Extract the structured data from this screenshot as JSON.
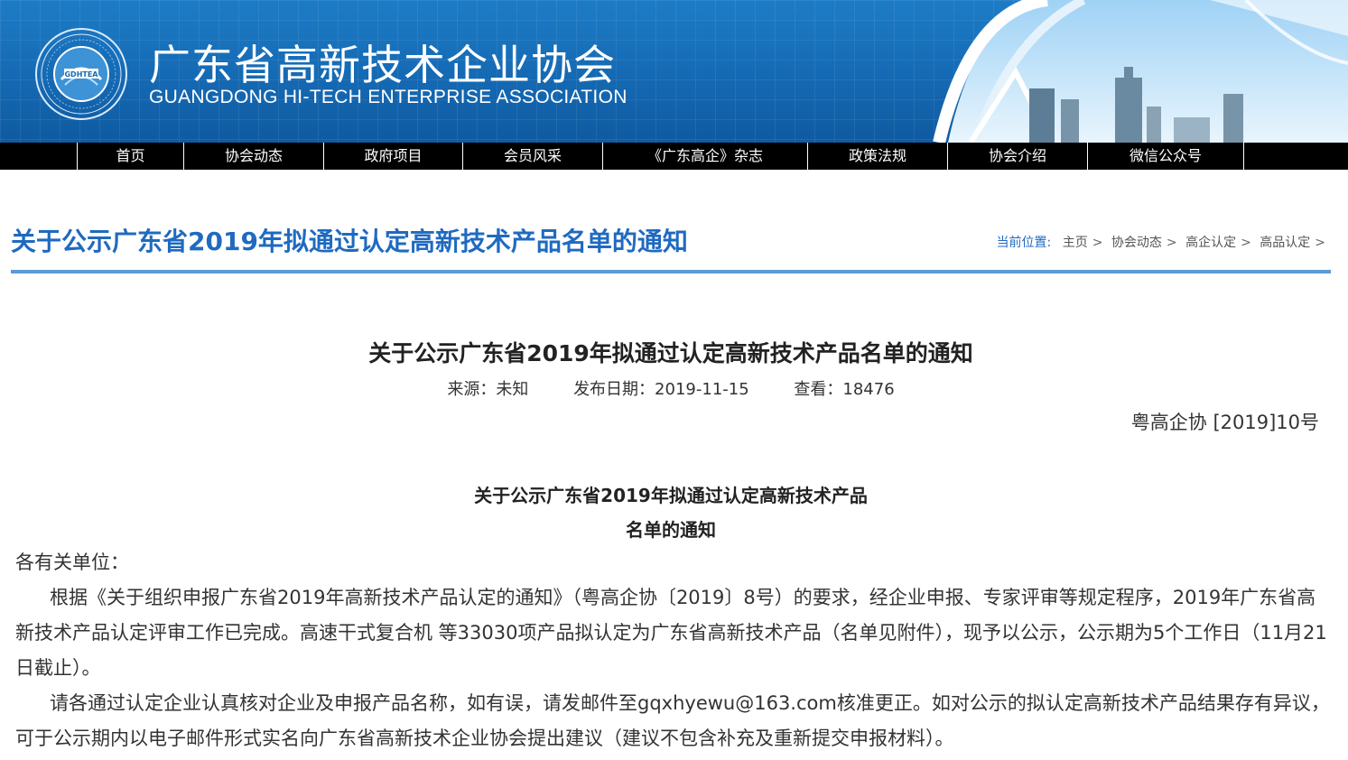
{
  "header": {
    "title_cn": "广东省高新技术企业协会",
    "title_en": "GUANGDONG HI-TECH ENTERPRISE ASSOCIATION",
    "logo_text": "GDHTEA",
    "colors": {
      "banner": "#1569b3",
      "nav": "#000000",
      "accent": "#1f6ac0"
    }
  },
  "nav": {
    "items": [
      {
        "label": "首页"
      },
      {
        "label": "协会动态"
      },
      {
        "label": "政府项目"
      },
      {
        "label": "会员风采"
      },
      {
        "label": "《广东高企》杂志"
      },
      {
        "label": "政策法规"
      },
      {
        "label": "协会介绍"
      },
      {
        "label": "微信公众号"
      }
    ]
  },
  "page": {
    "title": "关于公示广东省2019年拟通过认定高新技术产品名单的通知",
    "breadcrumb": {
      "label": "当前位置:",
      "items": [
        "主页",
        "协会动态",
        "高企认定",
        "高品认定"
      ],
      "separator": ">"
    }
  },
  "article": {
    "title": "关于公示广东省2019年拟通过认定高新技术产品名单的通知",
    "source": "来源：未知",
    "date": "发布日期：2019-11-15",
    "views": "查看：18476",
    "doc_number": "粤高企协 [2019]10号",
    "subtitle_line1": "关于公示广东省2019年拟通过认定高新技术产品",
    "subtitle_line2": "名单的通知",
    "salutation": "各有关单位：",
    "paragraph1": "根据《关于组织申报广东省2019年高新技术产品认定的通知》（粤高企协〔2019〕8号）的要求，经企业申报、专家评审等规定程序，2019年广东省高新技术产品认定评审工作已完成。高速干式复合机 等33030项产品拟认定为广东省高新技术产品（名单见附件），现予以公示，公示期为5个工作日（11月21日截止）。",
    "paragraph2": "请各通过认定企业认真核对企业及申报产品名称，如有误，请发邮件至gqxhyewu@163.com核准更正。如对公示的拟认定高新技术产品结果存有异议，可于公示期内以电子邮件形式实名向广东省高新技术企业协会提出建议（建议不包含补充及重新提交申报材料）。"
  }
}
